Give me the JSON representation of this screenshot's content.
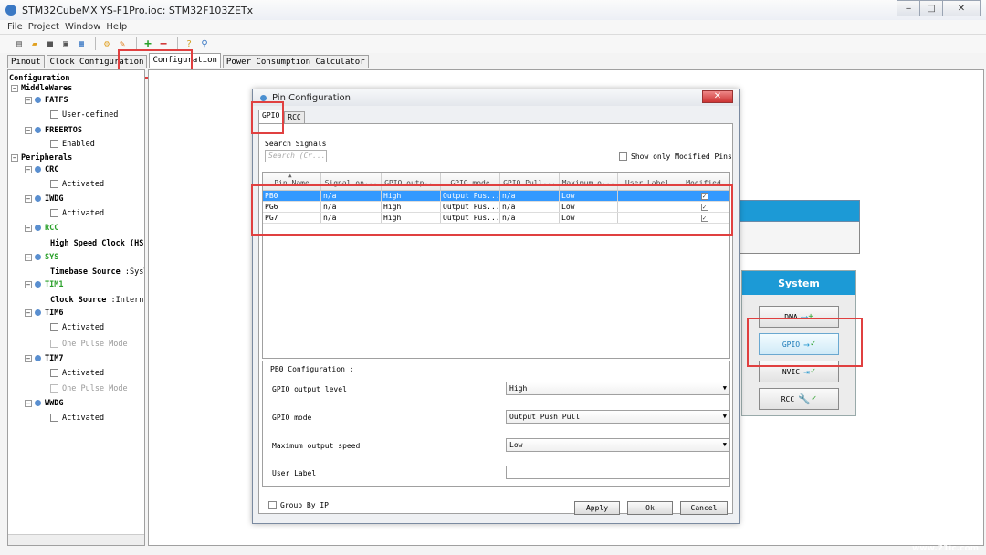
{
  "window": {
    "title": "STM32CubeMX YS-F1Pro.ioc: STM32F103ZETx",
    "min": "‒",
    "max": "□",
    "close": "✕"
  },
  "menu": [
    "File",
    "Project",
    "Window",
    "Help"
  ],
  "tabs": [
    {
      "label": "Pinout"
    },
    {
      "label": "Clock Configuration"
    },
    {
      "label": "Configuration"
    },
    {
      "label": "Power Consumption Calculator"
    }
  ],
  "tree": {
    "root": "Configuration",
    "middlewares": "MiddleWares",
    "fatfs": "FATFS",
    "fatfs_user": "User-defined",
    "freertos": "FREERTOS",
    "freertos_enabled": "Enabled",
    "peripherals": "Peripherals",
    "crc": "CRC",
    "crc_activated": "Activated",
    "iwdg": "IWDG",
    "iwdg_activated": "Activated",
    "rcc": "RCC",
    "rcc_hsc_label": "High Speed Clock (HS",
    "sys": "SYS",
    "sys_timebase_label": "Timebase Source",
    "sys_timebase_value": ":SysT",
    "tim1": "TIM1",
    "tim1_clock_label": "Clock Source",
    "tim1_clock_value": ":Interna",
    "tim6": "TIM6",
    "tim6_activated": "Activated",
    "tim6_onepulse": "One Pulse Mode",
    "tim7": "TIM7",
    "tim7_activated": "Activated",
    "tim7_onepulse": "One Pulse Mode",
    "wwdg": "WWDG",
    "wwdg_activated": "Activated"
  },
  "system": {
    "title": "System",
    "dma": "DMA",
    "gpio": "GPIO",
    "nvic": "NVIC",
    "rcc": "RCC"
  },
  "dialog": {
    "title": "Pin Configuration",
    "close": "✕",
    "tabs": [
      "GPIO",
      "RCC"
    ],
    "search_label": "Search Signals",
    "search_placeholder": "Search (Cr...",
    "show_modified": "Show only Modified Pins",
    "columns": [
      "Pin Name",
      "Signal on...",
      "GPIO outp...",
      "GPIO mode",
      "GPIO Pull...",
      "Maximum o...",
      "User Label",
      "Modified"
    ],
    "sort_arrow": "▲",
    "rows": [
      {
        "pin": "PB0",
        "signal": "n/a",
        "output": "High",
        "mode": "Output Pus...",
        "pull": "n/a",
        "speed": "Low",
        "label": "",
        "modified": "✓"
      },
      {
        "pin": "PG6",
        "signal": "n/a",
        "output": "High",
        "mode": "Output Pus...",
        "pull": "n/a",
        "speed": "Low",
        "label": "",
        "modified": "✓"
      },
      {
        "pin": "PG7",
        "signal": "n/a",
        "output": "High",
        "mode": "Output Pus...",
        "pull": "n/a",
        "speed": "Low",
        "label": "",
        "modified": "✓"
      }
    ],
    "config_title": "PB0 Configuration :",
    "fields": {
      "output_level_label": "GPIO output level",
      "output_level_value": "High",
      "mode_label": "GPIO mode",
      "mode_value": "Output Push Pull",
      "speed_label": "Maximum output speed",
      "speed_value": "Low",
      "user_label_label": "User Label",
      "user_label_value": ""
    },
    "group_by": "Group By IP",
    "apply": "Apply",
    "ok": "Ok",
    "cancel": "Cancel"
  },
  "watermark": {
    "brand": "21ic",
    "cn": "中国电子网",
    "url": "www.21ic.com"
  },
  "colors": {
    "accent": "#1c9ad6",
    "highlight": "#e04040",
    "selection": "#3399ff",
    "green": "#2aa02a"
  }
}
